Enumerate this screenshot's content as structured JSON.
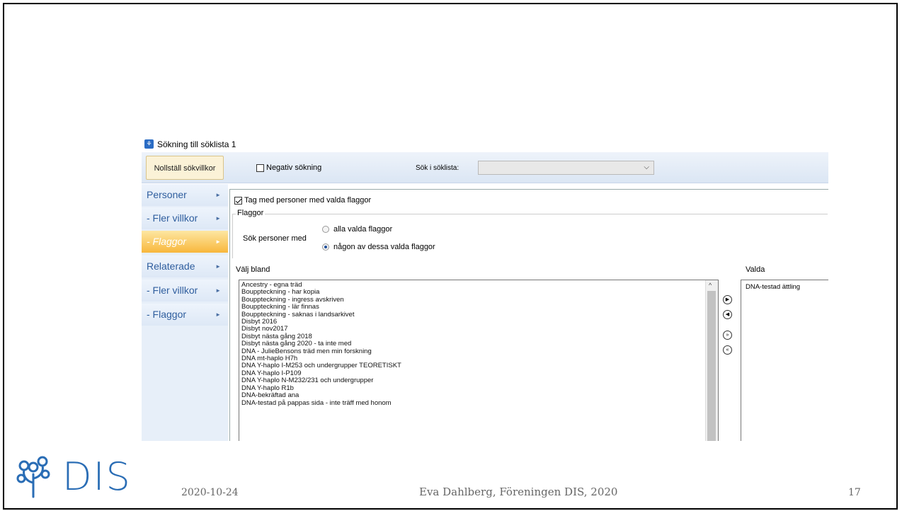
{
  "window": {
    "title": "Sökning till söklista 1"
  },
  "toolbar": {
    "reset_label": "Nollställ sökvillkor",
    "negative_label": "Negativ sökning",
    "negative_checked": false,
    "search_in_label": "Sök i söklista:",
    "search_in_value": ""
  },
  "sidebar": {
    "items": [
      {
        "label": "Personer",
        "active": false
      },
      {
        "label": "- Fler villkor",
        "active": false
      },
      {
        "label": "- Flaggor",
        "active": true
      },
      {
        "label": "Relaterade",
        "active": false
      },
      {
        "label": "- Fler villkor",
        "active": false
      },
      {
        "label": "- Flaggor",
        "active": false
      }
    ]
  },
  "main": {
    "take_label": "Tag med personer med valda flaggor",
    "take_checked": true,
    "flags_group_label": "Flaggor",
    "search_persons_label": "Sök personer med",
    "radio_all_label": "alla valda flaggor",
    "radio_any_label": "någon av dessa valda flaggor",
    "selected_radio": "any",
    "choose_from_label": "Välj bland",
    "selected_label": "Valda",
    "available_flags": [
      "Ancestry - egna träd",
      "Bouppteckning - har kopia",
      "Bouppteckning - ingress avskriven",
      "Bouppteckning - lär finnas",
      "Bouppteckning - saknas i landsarkivet",
      "Disbyt 2016",
      "Disbyt nov2017",
      "Disbyt nästa gång 2018",
      "Disbyt nästa gång 2020 - ta inte med",
      "DNA - JulieBensons träd men min forskning",
      "DNA mt-haplo H7h",
      "DNA Y-haplo I-M253 och undergrupper TEORETISKT",
      "DNA Y-haplo I-P109",
      "DNA Y-haplo N-M232/231 och undergrupper",
      "DNA Y-haplo R1b",
      "DNA-bekräftad ana",
      "DNA-testad på pappas sida - inte träff med honom"
    ],
    "selected_flags": [
      "DNA-testad ättling"
    ]
  },
  "footer": {
    "logo_text": "DIS",
    "date": "2020-10-24",
    "author": "Eva Dahlberg, Föreningen DIS, 2020",
    "page": "17"
  },
  "colors": {
    "accent_blue": "#2a6db5",
    "active_nav": "#f8b73c",
    "list_selection": "#2d7cc0"
  }
}
